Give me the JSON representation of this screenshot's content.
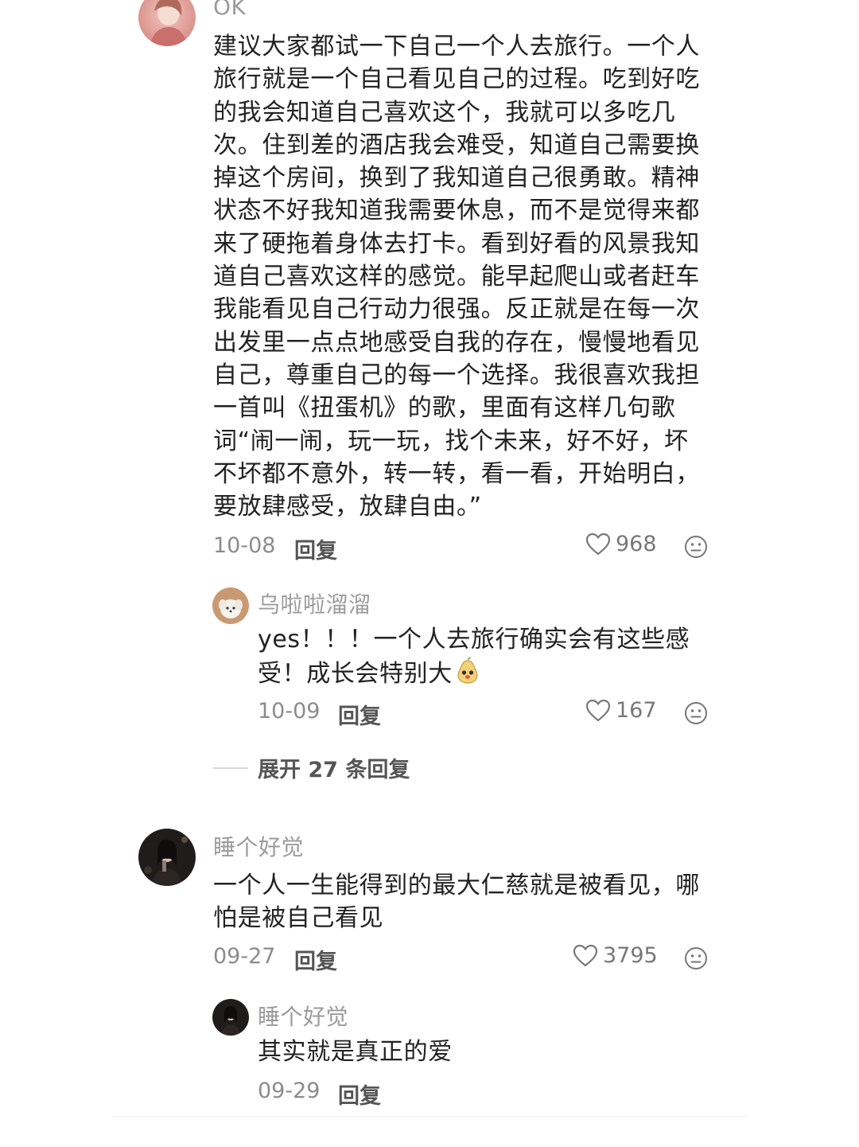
{
  "comments": [
    {
      "username": "OK",
      "text": "建议大家都试一下自己一个人去旅行。一个人旅行就是一个自己看见自己的过程。吃到好吃的我会知道自己喜欢这个，我就可以多吃几次。住到差的酒店我会难受，知道自己需要换掉这个房间，换到了我知道自己很勇敢。精神状态不好我知道我需要休息，而不是觉得来都来了硬拖着身体去打卡。看到好看的风景我知道自己喜欢这样的感觉。能早起爬山或者赶车我能看见自己行动力很强。反正就是在每一次出发里一点点地感受自我的存在，慢慢地看见自己，尊重自己的每一个选择。我很喜欢我担一首叫《扭蛋机》的歌，里面有这样几句歌词“闹一闹，玩一玩，找个未来，好不好，坏不坏都不意外，转一转，看一看，开始明白，要放肆感受，放肆自由。”",
      "date": "10-08",
      "reply_label": "回复",
      "likes": "968",
      "reply": {
        "username": "乌啦啦溜溜",
        "text": "yes！！！一个人去旅行确实会有这些感受！成长会特别大",
        "date": "10-09",
        "reply_label": "回复",
        "likes": "167"
      },
      "expand_label": "展开 27 条回复"
    },
    {
      "username": "睡个好觉",
      "text": "一个人一生能得到的最大仁慈就是被看见，哪怕是被自己看见",
      "date": "09-27",
      "reply_label": "回复",
      "likes": "3795",
      "reply": {
        "username": "睡个好觉",
        "text": "其实就是真正的爱",
        "date": "09-29",
        "reply_label": "回复"
      }
    }
  ],
  "icons": {
    "like": "heart-outline-icon",
    "dislike": "neutral-face-icon",
    "emoji": "pear-face-emoji"
  },
  "colors": {
    "text": "#222222",
    "muted": "#9b9b9b",
    "icon": "#777777"
  }
}
